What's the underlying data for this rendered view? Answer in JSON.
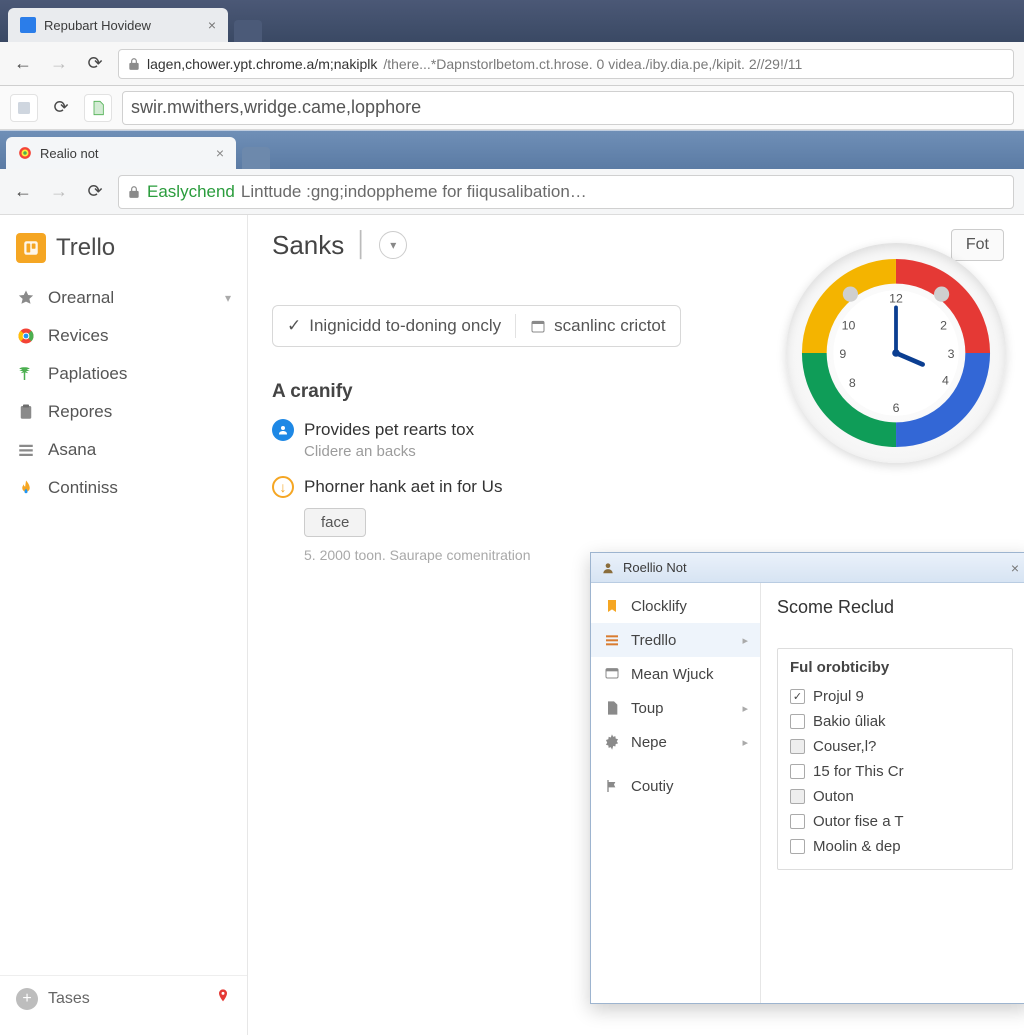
{
  "outerBrowser": {
    "tab": {
      "title": "Repubart Hovidew"
    },
    "address": {
      "host": "lagen,chower.ypt.chrome.a/m;nakiplk",
      "path": " /there...*Dapnstorlbetom.ct.hrose.  0 videa./iby.dia.pe,/kipit. 2//29!/11"
    },
    "secondAddress": "swir.mwithers,wridge.came,lopphore"
  },
  "innerBrowser": {
    "tab": {
      "title": "Realio not"
    },
    "address": {
      "green": "Easlychend",
      "rest": "Linttude :gng;indoppheme for fiiqusalibation…"
    }
  },
  "sidebar": {
    "brand": "Trello",
    "items": [
      {
        "label": "Orearnal",
        "hasChevron": true
      },
      {
        "label": "Revices"
      },
      {
        "label": "Paplatioes"
      },
      {
        "label": "Repores"
      },
      {
        "label": "Asana"
      },
      {
        "label": "Continiss"
      }
    ],
    "footer": {
      "label": "Tases"
    }
  },
  "main": {
    "title": "Sanks",
    "headButton": "Fot",
    "filter": {
      "left": "Inignicidd to-doning oncly",
      "right": "scanlinc crictot"
    },
    "sectionTitle": "A cranify",
    "entry1": {
      "title": "Provides pet rearts tox",
      "sub": "Clidere an backs"
    },
    "entry2": {
      "title": "Phorner hank aet in for Us",
      "button": "face",
      "meta": "5. 2000 toon. Saurape comenitration"
    }
  },
  "popup": {
    "titlebar": "Roellio Not",
    "side": [
      {
        "label": "Clocklify"
      },
      {
        "label": "Tredllo",
        "active": true,
        "chev": true
      },
      {
        "label": "Mean Wjuck"
      },
      {
        "label": "Toup",
        "chev": true
      },
      {
        "label": "Nepe",
        "chev": true
      },
      {
        "label": "Coutiy"
      }
    ],
    "heading": "Scome Reclud",
    "groupTitle": "Ful orobticiby",
    "checks": [
      {
        "label": "Projul 9",
        "checked": true
      },
      {
        "label": "Bakio ûliak"
      },
      {
        "label": "Couser,l?",
        "grey": true
      },
      {
        "label": "15 for This Cr"
      },
      {
        "label": "Outon",
        "grey": true
      },
      {
        "label": "Outor fise a T"
      },
      {
        "label": "Moolin & dep"
      }
    ]
  }
}
